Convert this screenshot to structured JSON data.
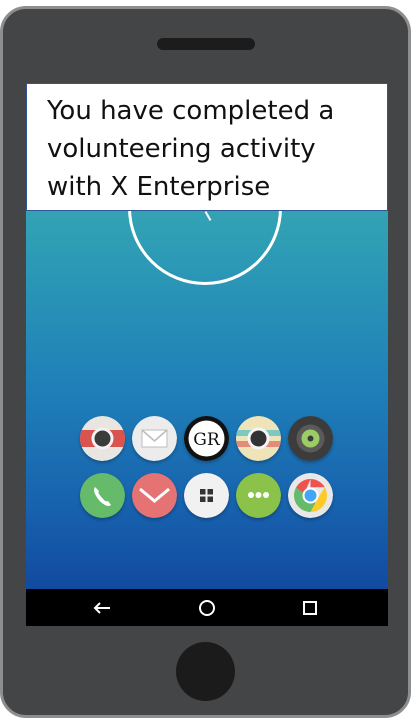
{
  "notification": {
    "line1": "You have completed a",
    "line2": "volunteering activity",
    "line3": "with X Enterprise"
  },
  "apps": {
    "row1": [
      "camera-icon",
      "mail-icon",
      "gr-app-icon",
      "camera-alt-icon",
      "music-icon"
    ],
    "row2": [
      "phone-icon",
      "gmail-icon",
      "apps-grid-icon",
      "messages-icon",
      "chrome-icon"
    ],
    "gr_label": "GR"
  },
  "navbar": {
    "back_icon": "back-arrow-icon",
    "home_icon": "home-circle-icon",
    "recents_icon": "recents-square-icon"
  },
  "colors": {
    "phone_body": "#444547",
    "screen_top": "#4fb3ad",
    "screen_bottom": "#124aa0",
    "notification_border": "#2f5597"
  }
}
